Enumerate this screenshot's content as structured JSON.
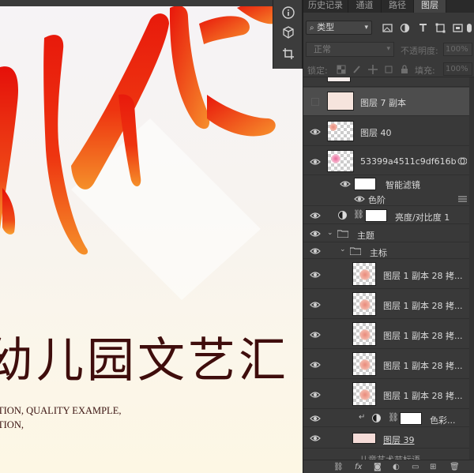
{
  "canvas": {
    "title_cn": "幼儿园文艺汇",
    "subtitle_lines": [
      "TION, QUALITY EXAMPLE,",
      "TION,"
    ],
    "brand_colors": {
      "red": "#e8170c",
      "orange": "#f39a2a",
      "title": "#3f0d0c"
    }
  },
  "toolstrip": {
    "tools": [
      "info-icon",
      "3d-cube-icon",
      "crop-icon"
    ]
  },
  "panel": {
    "tabs": [
      "历史记录",
      "通道",
      "路径",
      "图层"
    ],
    "active_tab": "图层",
    "filter": {
      "kind_label": "类型",
      "icons": [
        "image-filter-icon",
        "adjustment-filter-icon",
        "type-filter-icon",
        "shape-filter-icon",
        "smart-object-filter-icon",
        "toggle-filter-icon"
      ]
    },
    "blend": {
      "mode": "正常",
      "opacity_label": "不透明度:",
      "opacity_value": "100%"
    },
    "lock": {
      "label": "锁定:",
      "fill_label": "填充:",
      "fill_value": "100%"
    },
    "layers": [
      {
        "name": "",
        "visible": false,
        "kind": "image-clipped"
      },
      {
        "name": "图层 7 副本",
        "visible": false,
        "selected": true,
        "kind": "image"
      },
      {
        "name": "图层 40",
        "visible": true,
        "kind": "image"
      },
      {
        "name": "53399a4511c9df616bf...",
        "visible": true,
        "kind": "smart"
      },
      {
        "name": "智能滤镜",
        "visible": true,
        "kind": "filter-mask"
      },
      {
        "name": "色阶",
        "visible": true,
        "kind": "filter"
      },
      {
        "name": "亮度/对比度 1",
        "visible": true,
        "kind": "adjustment"
      },
      {
        "name": "主题",
        "visible": true,
        "kind": "group"
      },
      {
        "name": "主标",
        "visible": true,
        "kind": "group"
      },
      {
        "name": "图层 1 副本 28 拷...",
        "visible": true,
        "kind": "image"
      },
      {
        "name": "图层 1 副本 28 拷...",
        "visible": true,
        "kind": "image"
      },
      {
        "name": "图层 1 副本 28 拷...",
        "visible": true,
        "kind": "image"
      },
      {
        "name": "图层 1 副本 28 拷...",
        "visible": true,
        "kind": "image"
      },
      {
        "name": "图层 1 副本 28 拷...",
        "visible": true,
        "kind": "image"
      },
      {
        "name": "色彩...",
        "visible": true,
        "kind": "adjustment-clipped"
      },
      {
        "name": "图层 39",
        "visible": true,
        "kind": "image"
      },
      {
        "name": "…儿童艺术节标语…",
        "visible": false,
        "kind": "text"
      }
    ],
    "bottom_icons": [
      "link-icon",
      "fx-icon",
      "mask-icon",
      "adjustment-icon",
      "folder-icon",
      "new-layer-icon",
      "trash-icon"
    ],
    "bottom_labels": {
      "fx": "fx"
    }
  }
}
